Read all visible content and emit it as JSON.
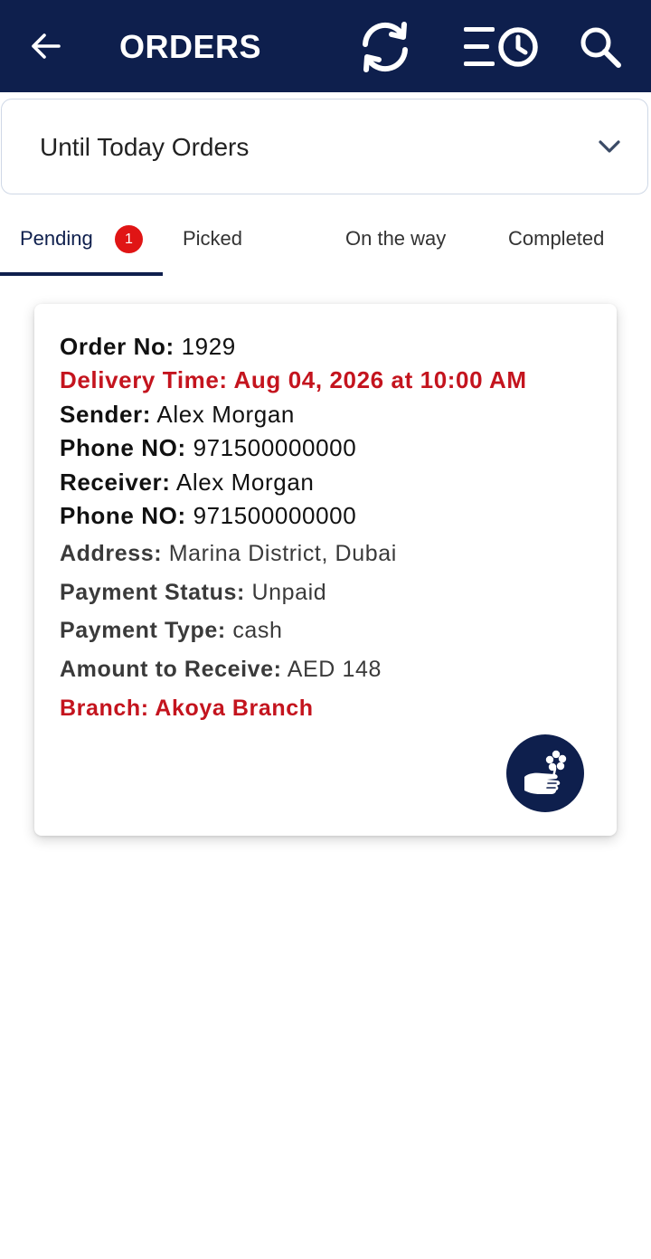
{
  "header": {
    "title": "ORDERS",
    "color": "#0e1f4d"
  },
  "filter": {
    "selected": "Until Today Orders"
  },
  "tabs": [
    {
      "label": "Pending",
      "badge": "1",
      "active": true
    },
    {
      "label": "Picked"
    },
    {
      "label": "On the way"
    },
    {
      "label": "Completed"
    }
  ],
  "order": {
    "order_no_label": "Order No:",
    "order_no": "1929",
    "delivery_time_label": "Delivery Time:",
    "delivery_time": "Aug 04, 2026 at 10:00 AM",
    "sender_label": "Sender:",
    "sender": "Alex Morgan",
    "sender_phone_label": "Phone NO:",
    "sender_phone": "971500000000",
    "receiver_label": "Receiver:",
    "receiver": "Alex Morgan",
    "receiver_phone_label": "Phone NO:",
    "receiver_phone": "971500000000",
    "address_label": "Address:",
    "address": "Marina District, Dubai",
    "payment_status_label": "Payment Status:",
    "payment_status": "Unpaid",
    "payment_type_label": "Payment Type:",
    "payment_type": "cash",
    "amount_label": "Amount to Receive:",
    "amount": "AED 148",
    "branch_label": "Branch:",
    "branch": "Akoya Branch"
  },
  "icons": {
    "back": "arrow-left-icon",
    "refresh": "refresh-icon",
    "history": "history-list-icon",
    "search": "search-icon",
    "chevron": "chevron-down-icon",
    "pickup": "hand-flower-icon"
  },
  "colors": {
    "accent": "#0e1f4d",
    "alert": "#c4141e",
    "badge": "#e01515"
  }
}
